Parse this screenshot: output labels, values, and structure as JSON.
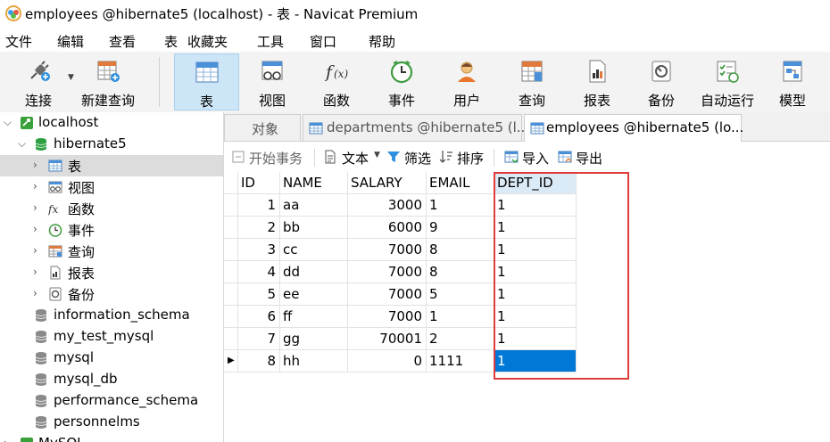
{
  "window": {
    "title": "employees @hibernate5 (localhost) - 表 - Navicat Premium"
  },
  "menu": [
    "文件",
    "编辑",
    "查看",
    "表",
    "收藏夹",
    "工具",
    "窗口",
    "帮助"
  ],
  "toolbar": {
    "connect": "连接",
    "new_query": "新建查询",
    "table": "表",
    "view": "视图",
    "function": "函数",
    "event": "事件",
    "user": "用户",
    "query": "查询",
    "report": "报表",
    "backup": "备份",
    "automation": "自动运行",
    "model": "模型"
  },
  "tree": {
    "connection": "localhost",
    "database": "hibernate5",
    "children": [
      "表",
      "视图",
      "函数",
      "事件",
      "查询",
      "报表",
      "备份"
    ],
    "other_dbs": [
      "information_schema",
      "my_test_mysql",
      "mysql",
      "mysql_db",
      "performance_schema",
      "personnelms",
      "MySQL"
    ]
  },
  "tabs": {
    "objects": "对象",
    "departments": "departments @hibernate5 (l...",
    "employees": "employees @hibernate5 (lo..."
  },
  "subtoolbar": {
    "begin_transaction": "开始事务",
    "text": "文本",
    "filter": "筛选",
    "sort": "排序",
    "import": "导入",
    "export": "导出"
  },
  "table": {
    "columns": [
      "ID",
      "NAME",
      "SALARY",
      "EMAIL",
      "DEPT_ID"
    ],
    "rows": [
      [
        "1",
        "aa",
        "3000",
        "1",
        "1"
      ],
      [
        "2",
        "bb",
        "6000",
        "9",
        "1"
      ],
      [
        "3",
        "cc",
        "7000",
        "8",
        "1"
      ],
      [
        "4",
        "dd",
        "7000",
        "8",
        "1"
      ],
      [
        "5",
        "ee",
        "7000",
        "5",
        "1"
      ],
      [
        "6",
        "ff",
        "7000",
        "1",
        "1"
      ],
      [
        "7",
        "gg",
        "70001",
        "2",
        "1"
      ],
      [
        "8",
        "hh",
        "0",
        "1111",
        "1"
      ]
    ],
    "current_row_index": 7,
    "selected_column": "DEPT_ID"
  },
  "colors": {
    "accent": "#0078d7",
    "selection": "#0078d7",
    "highlight_border": "#e03c3c",
    "toolbar_active": "#cde6f7"
  }
}
